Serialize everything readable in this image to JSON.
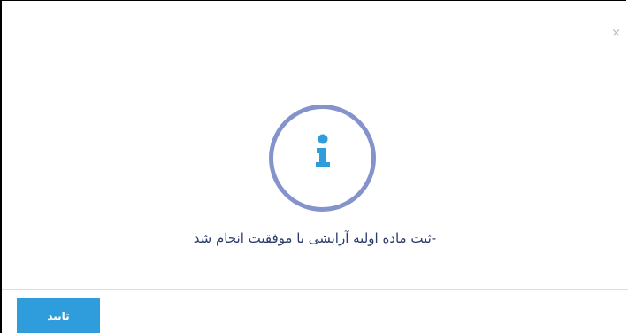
{
  "dialog": {
    "close_label": "×",
    "icon": "info-icon",
    "icon_color": "#2f9ddb",
    "ring_color": "#8593cc",
    "message": "-ثبت ماده اولیه آرایشی با موفقیت انجام شد",
    "confirm_label": "تایید",
    "confirm_color": "#2f9ddb"
  }
}
